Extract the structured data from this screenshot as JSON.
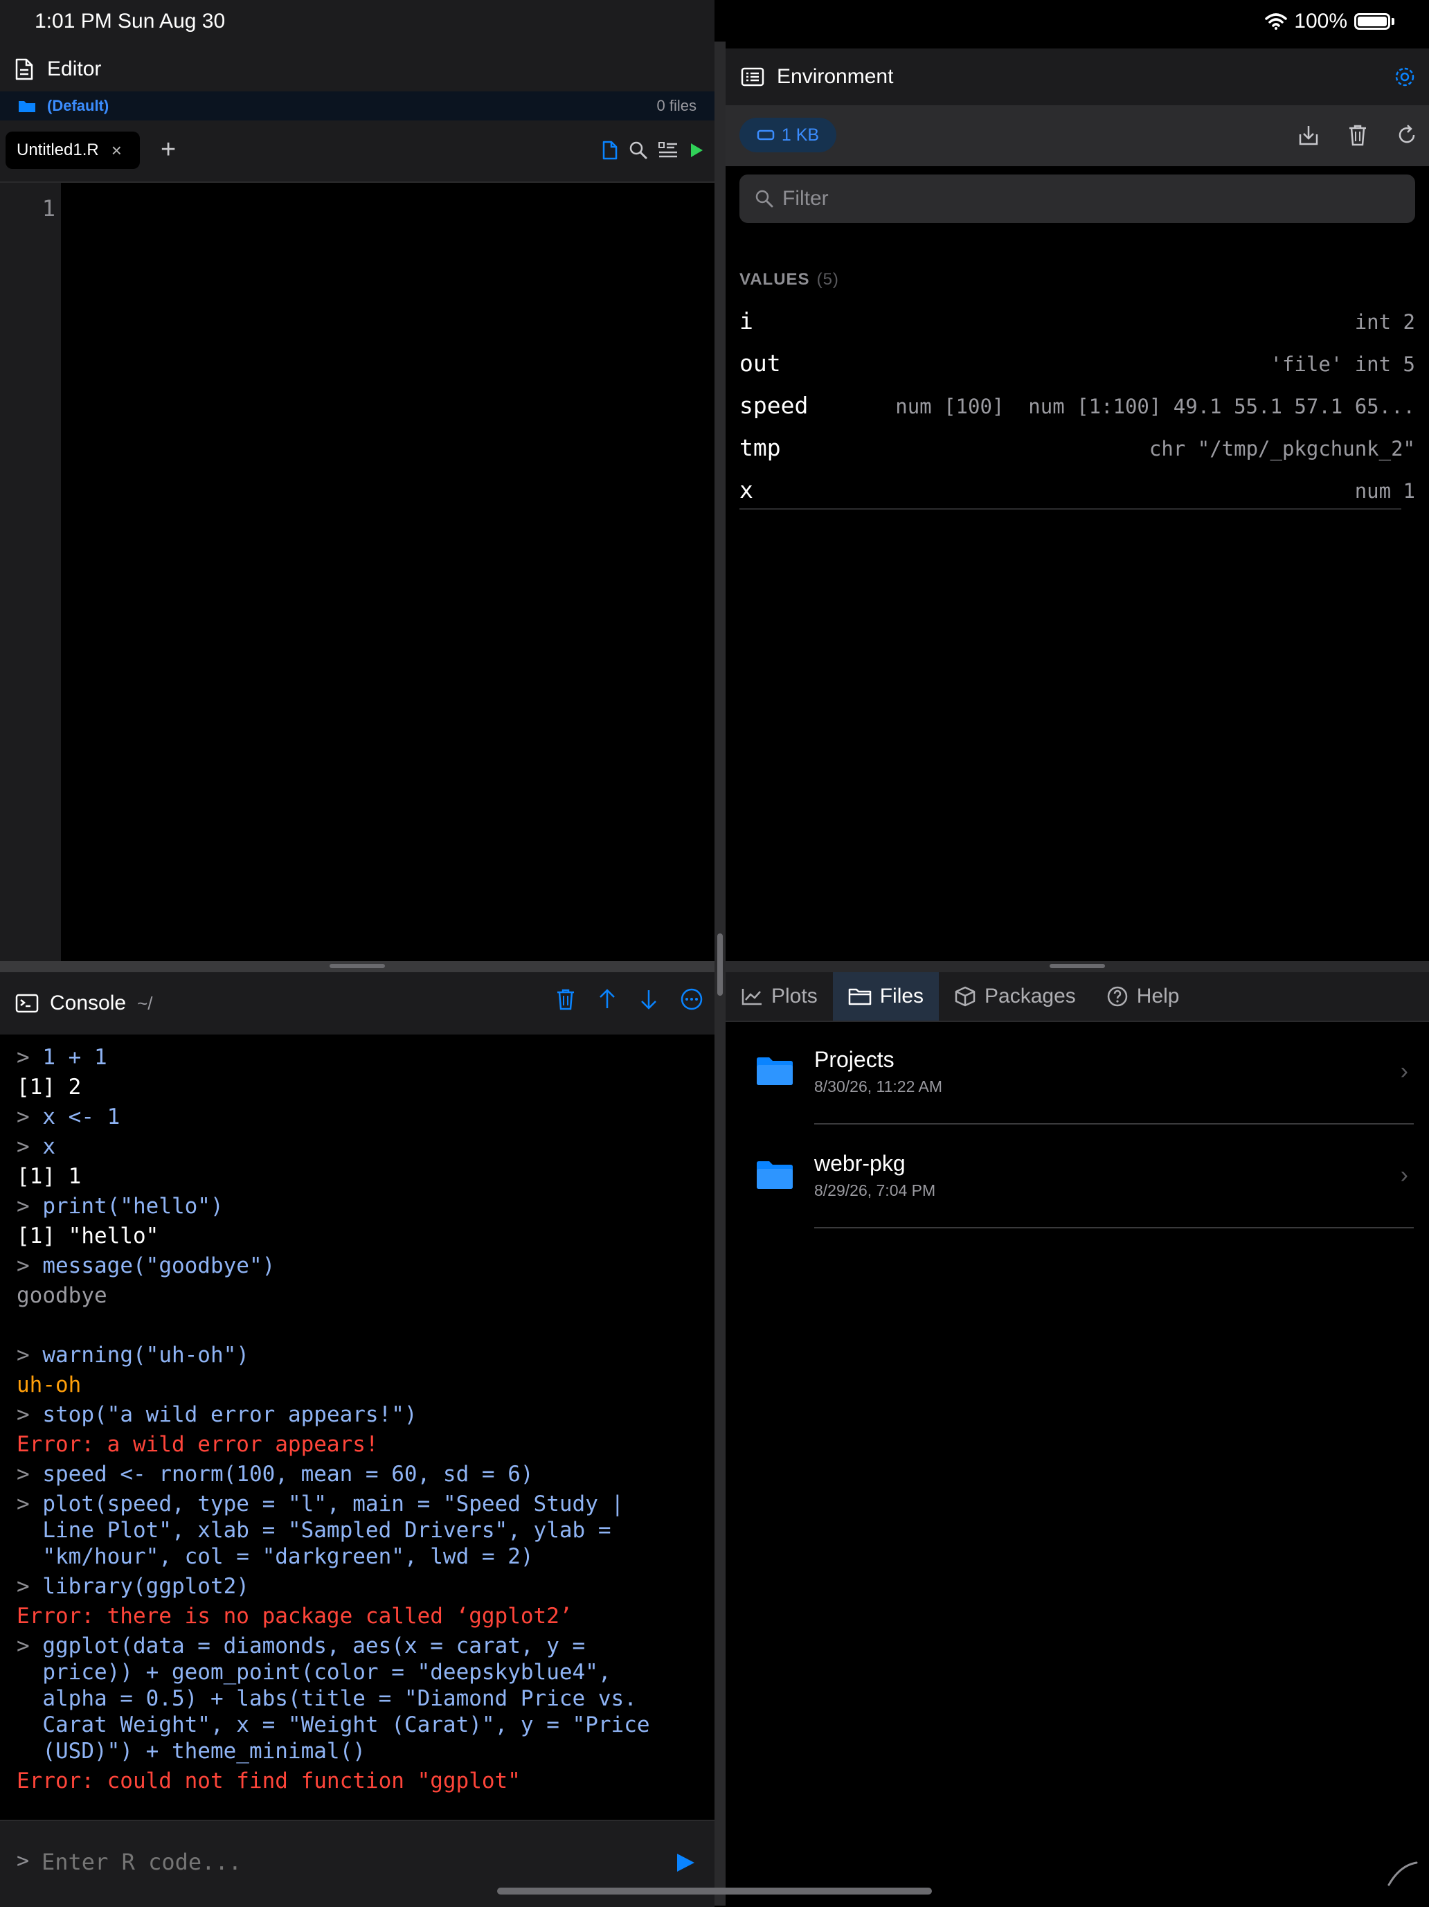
{
  "status": {
    "time": "1:01 PM",
    "date": "Sun Aug 30",
    "battery": "100%"
  },
  "editor": {
    "title": "Editor",
    "project": "(Default)",
    "files_count": "0 files",
    "tab_label": "Untitled1.R",
    "tab_close": "×",
    "add_tab": "+",
    "line_number": "1"
  },
  "console": {
    "title": "Console",
    "path": "~/",
    "prompt": ">",
    "lines": [
      {
        "type": "cmd",
        "text": "1 + 1"
      },
      {
        "type": "out",
        "text": "[1] 2"
      },
      {
        "type": "cmd",
        "text": "x <- 1"
      },
      {
        "type": "cmd",
        "text": "x"
      },
      {
        "type": "out",
        "text": "[1] 1"
      },
      {
        "type": "cmd",
        "text": "print(\"hello\")"
      },
      {
        "type": "out",
        "text": "[1] \"hello\""
      },
      {
        "type": "cmd",
        "text": "message(\"goodbye\")"
      },
      {
        "type": "msg",
        "text": "goodbye"
      },
      {
        "type": "cmd",
        "text": "warning(\"uh-oh\")"
      },
      {
        "type": "warn",
        "text": "uh-oh"
      },
      {
        "type": "cmd",
        "text": "stop(\"a wild error appears!\")"
      },
      {
        "type": "err",
        "text": "Error: a wild error appears!"
      },
      {
        "type": "cmd",
        "text": "speed <- rnorm(100, mean = 60, sd = 6)"
      },
      {
        "type": "cmd",
        "text": "plot(speed, type = \"l\", main = \"Speed Study |"
      },
      {
        "type": "cont",
        "text": "Line Plot\", xlab = \"Sampled Drivers\", ylab ="
      },
      {
        "type": "cont",
        "text": "\"km/hour\", col = \"darkgreen\", lwd = 2)"
      },
      {
        "type": "cmd",
        "text": "library(ggplot2)"
      },
      {
        "type": "err",
        "text": "Error: there is no package called ‘ggplot2’"
      },
      {
        "type": "cmd",
        "text": "ggplot(data = diamonds, aes(x = carat, y ="
      },
      {
        "type": "cont",
        "text": "price)) + geom_point(color = \"deepskyblue4\","
      },
      {
        "type": "cont",
        "text": "alpha = 0.5) + labs(title = \"Diamond Price vs."
      },
      {
        "type": "cont",
        "text": "Carat Weight\", x = \"Weight (Carat)\", y = \"Price"
      },
      {
        "type": "cont",
        "text": "(USD)\") + theme_minimal()"
      },
      {
        "type": "err",
        "text": "Error: could not find function \"ggplot\""
      }
    ],
    "input_placeholder": "Enter R code..."
  },
  "environment": {
    "title": "Environment",
    "memory": "1  KB",
    "filter_placeholder": "Filter",
    "values_label": "VALUES",
    "values_count": "(5)",
    "values": [
      {
        "name": "i",
        "value": "int 2"
      },
      {
        "name": "out",
        "value": "'file' int 5"
      },
      {
        "name": "speed",
        "value": "num [100]  num [1:100] 49.1 55.1 57.1 65..."
      },
      {
        "name": "tmp",
        "value": "chr \"/tmp/_pkgchunk_2\""
      },
      {
        "name": "x",
        "value": "num 1"
      }
    ]
  },
  "bottom_tabs": [
    {
      "label": "Plots",
      "icon": "chart-line-icon"
    },
    {
      "label": "Files",
      "icon": "folder-outline-icon"
    },
    {
      "label": "Packages",
      "icon": "package-icon"
    },
    {
      "label": "Help",
      "icon": "help-circle-icon"
    }
  ],
  "files": [
    {
      "name": "Projects",
      "date": "8/30/26, 11:22 AM"
    },
    {
      "name": "webr-pkg",
      "date": "8/29/26, 7:04 PM"
    }
  ],
  "colors": {
    "accent": "#0a84ff",
    "error": "#ff453a",
    "warning": "#ff9f0a",
    "command": "#8fb4f5",
    "run": "#30d158"
  }
}
